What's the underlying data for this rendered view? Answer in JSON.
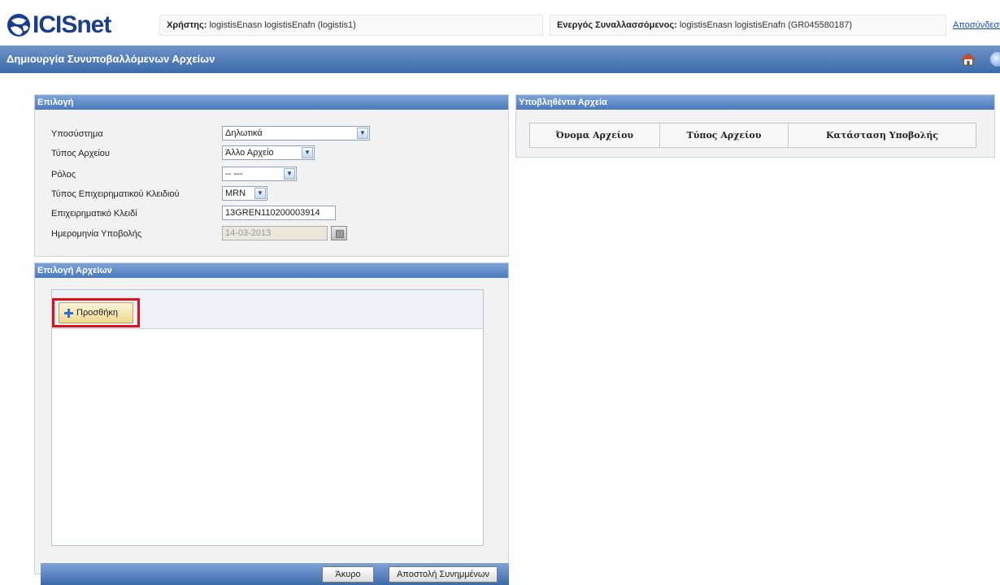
{
  "header": {
    "logo_text": "ICISnet",
    "user_label": "Χρήστης:",
    "user_value": "logistisEnasn logistisEnafn (logistis1)",
    "actor_label": "Ενεργός Συναλλασσόμενος:",
    "actor_value": "logistisEnasn logistisEnafn (GR045580187)",
    "logout_text": "Αποσύνδεση"
  },
  "titlebar": {
    "title": "Δημιουργία Συνυποβαλλόμενων Αρχείων"
  },
  "selection": {
    "heading": "Επιλογή",
    "fields": [
      {
        "label": "Υποσύστημα",
        "value": "Δηλωτικά"
      },
      {
        "label": "Τύπος Αρχείου",
        "value": "Άλλο Αρχείο"
      },
      {
        "label": "Ρόλος",
        "value": "-- ---"
      },
      {
        "label": "Τύπος Επιχειρηματικού Κλειδιού",
        "value": "MRN"
      },
      {
        "label": "Επιχειρηματικό Κλειδί",
        "value": "13GREN110200003914"
      },
      {
        "label": "Ημερομηνία Υποβολής",
        "value": "14-03-2013"
      }
    ]
  },
  "files_selection": {
    "heading": "Επιλογή Αρχείων",
    "add_button": "Προσθήκη"
  },
  "submitted": {
    "heading": "Υποβληθέντα Αρχεία",
    "columns": [
      "Όνομα Αρχείου",
      "Τύπος Αρχείου",
      "Κατάσταση Υποβολής"
    ]
  },
  "actions": {
    "cancel": "Άκυρο",
    "send": "Αποστολή Συνημμένων"
  },
  "colors": {
    "brand": "#1a3e8a",
    "titlebar": "#3c6aab",
    "highlight": "#e0101a"
  }
}
